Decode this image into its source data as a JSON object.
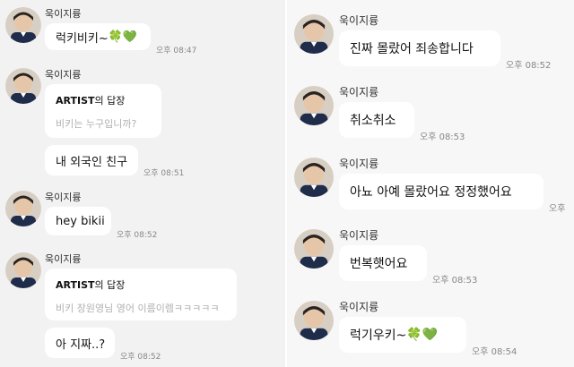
{
  "sender_name": "욱이지륭",
  "left_messages": [
    {
      "text": "럭키비키~",
      "emoji": [
        "🍀",
        "💚"
      ],
      "time": "오후 08:47"
    },
    {
      "reply_to_artist": "ARTIST",
      "reply_suffix": "의 답장",
      "quote": "비키는 누구입니까?",
      "text": "내 외국인 친구",
      "time": "오후 08:51"
    },
    {
      "text": "hey bikii",
      "time": "오후 08:52"
    },
    {
      "reply_to_artist": "ARTIST",
      "reply_suffix": "의 답장",
      "quote": "비키 장원영님 영어 이름이렘ㅋㅋㅋㅋㅋ",
      "text": "아 지짜..?",
      "time": "오후 08:52"
    }
  ],
  "right_messages": [
    {
      "text": "진짜 몰랐어 죄송합니다",
      "time": "오후 08:52"
    },
    {
      "text": "취소취소",
      "time": "오후 08:53"
    },
    {
      "text": "아뇨 아예 몰랐어요 정정했어요",
      "time": "오후"
    },
    {
      "text": "번복햇어요",
      "time": "오후 08:53"
    },
    {
      "text": "럭기우키~",
      "emoji": [
        "🍀",
        "💚"
      ],
      "time": "오후 08:54"
    }
  ]
}
